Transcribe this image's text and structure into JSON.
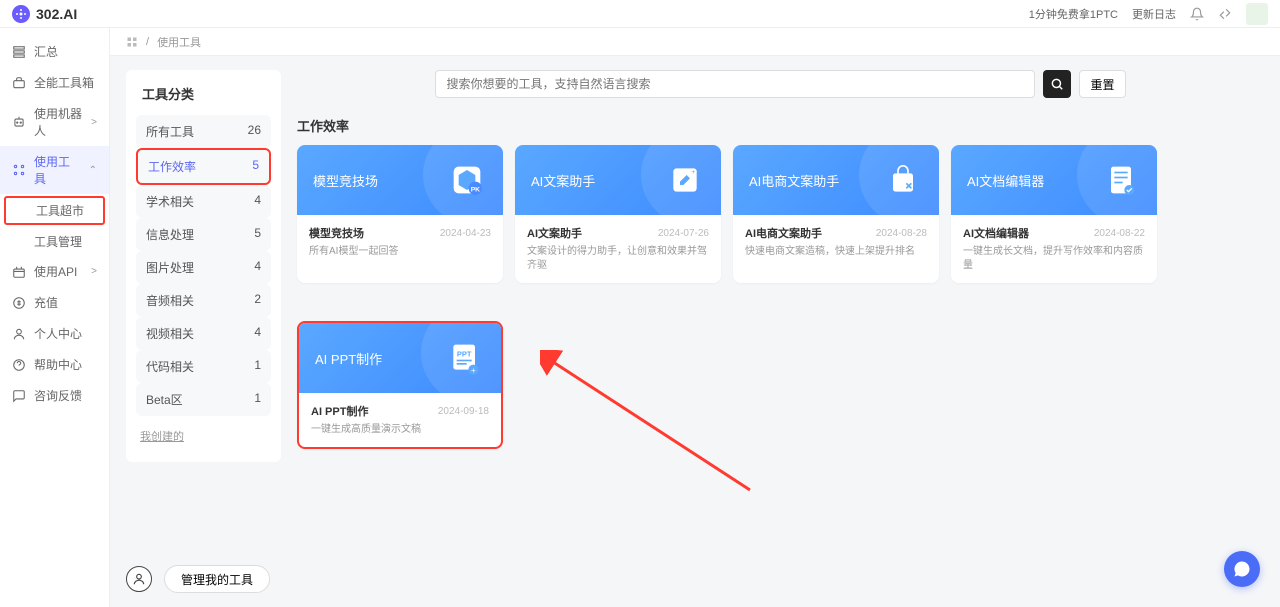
{
  "brand": "302.AI",
  "header": {
    "promo": "1分钟免费拿1PTC",
    "changelog": "更新日志"
  },
  "sidebar": {
    "items": [
      {
        "label": "汇总",
        "key": "summary"
      },
      {
        "label": "全能工具箱",
        "key": "toolbox"
      },
      {
        "label": "使用机器人",
        "key": "bots",
        "chev": ">"
      },
      {
        "label": "使用工具",
        "key": "tools",
        "chev": "⌃",
        "active": true
      },
      {
        "label": "使用API",
        "key": "api",
        "chev": ">"
      },
      {
        "label": "充值",
        "key": "recharge"
      },
      {
        "label": "个人中心",
        "key": "profile"
      },
      {
        "label": "帮助中心",
        "key": "help"
      },
      {
        "label": "咨询反馈",
        "key": "feedback"
      }
    ],
    "subs": [
      {
        "label": "工具超市",
        "hl": true
      },
      {
        "label": "工具管理"
      }
    ]
  },
  "breadcrumb": {
    "a": "使用工具"
  },
  "categories": {
    "title": "工具分类",
    "items": [
      {
        "label": "所有工具",
        "count": "26"
      },
      {
        "label": "工作效率",
        "count": "5",
        "sel": true
      },
      {
        "label": "学术相关",
        "count": "4"
      },
      {
        "label": "信息处理",
        "count": "5"
      },
      {
        "label": "图片处理",
        "count": "4"
      },
      {
        "label": "音频相关",
        "count": "2"
      },
      {
        "label": "视频相关",
        "count": "4"
      },
      {
        "label": "代码相关",
        "count": "1"
      },
      {
        "label": "Beta区",
        "count": "1"
      }
    ],
    "back": "我创建的"
  },
  "search": {
    "placeholder": "搜索你想要的工具，支持自然语言搜索",
    "reset": "重置"
  },
  "section": "工作效率",
  "cards": [
    {
      "heading": "模型竞技场",
      "name": "模型竞技场",
      "date": "2024-04-23",
      "desc": "所有AI模型一起回答",
      "icon": "cube"
    },
    {
      "heading": "AI文案助手",
      "name": "AI文案助手",
      "date": "2024-07-26",
      "desc": "文案设计的得力助手，让创意和效果并驾齐驱",
      "icon": "edit"
    },
    {
      "heading": "AI电商文案助手",
      "name": "AI电商文案助手",
      "date": "2024-08-28",
      "desc": "快速电商文案造稿，快速上架提升排名",
      "icon": "bag"
    },
    {
      "heading": "AI文档编辑器",
      "name": "AI文档编辑器",
      "date": "2024-08-22",
      "desc": "一键生成长文档，提升写作效率和内容质量",
      "icon": "doc"
    },
    {
      "heading": "AI PPT制作",
      "name": "AI PPT制作",
      "date": "2024-09-18",
      "desc": "一键生成高质量演示文稿",
      "icon": "ppt",
      "hl": true
    }
  ],
  "manage": "管理我的工具"
}
